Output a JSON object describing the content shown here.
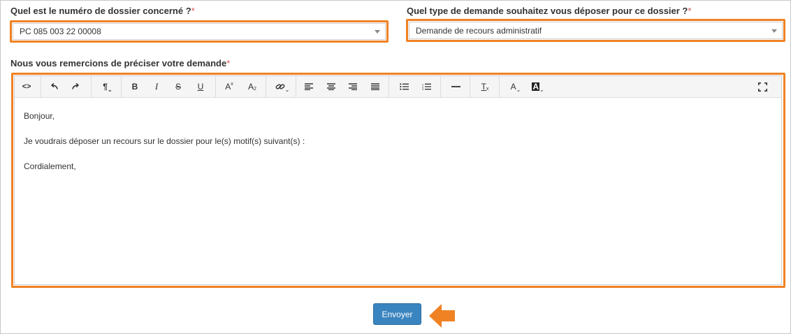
{
  "dossier": {
    "label": "Quel est le numéro de dossier concerné ?",
    "required_mark": "*",
    "value": "PC 085 003 22 00008"
  },
  "demand_type": {
    "label": "Quel type de demande souhaitez vous déposer pour ce dossier ?",
    "required_mark": "*",
    "value": "Demande de recours administratif"
  },
  "message": {
    "label": "Nous vous remercions de préciser votre demande",
    "required_mark": "*",
    "lines": [
      "Bonjour,",
      "Je voudrais déposer un recours sur le dossier pour le(s) motif(s) suivant(s) :",
      "Cordialement,"
    ]
  },
  "toolbar": {
    "code_view": "<>",
    "paragraph": "¶",
    "bold": "B",
    "italic": "I",
    "strike": "S",
    "underline": "U",
    "superscript": "A",
    "subscript": "A",
    "clear_format": "T",
    "font_color": "A",
    "bg_color": "A"
  },
  "submit_label": "Envoyer",
  "colors": {
    "highlight": "#f08224",
    "button": "#3a84bf",
    "required": "#d9534f"
  }
}
